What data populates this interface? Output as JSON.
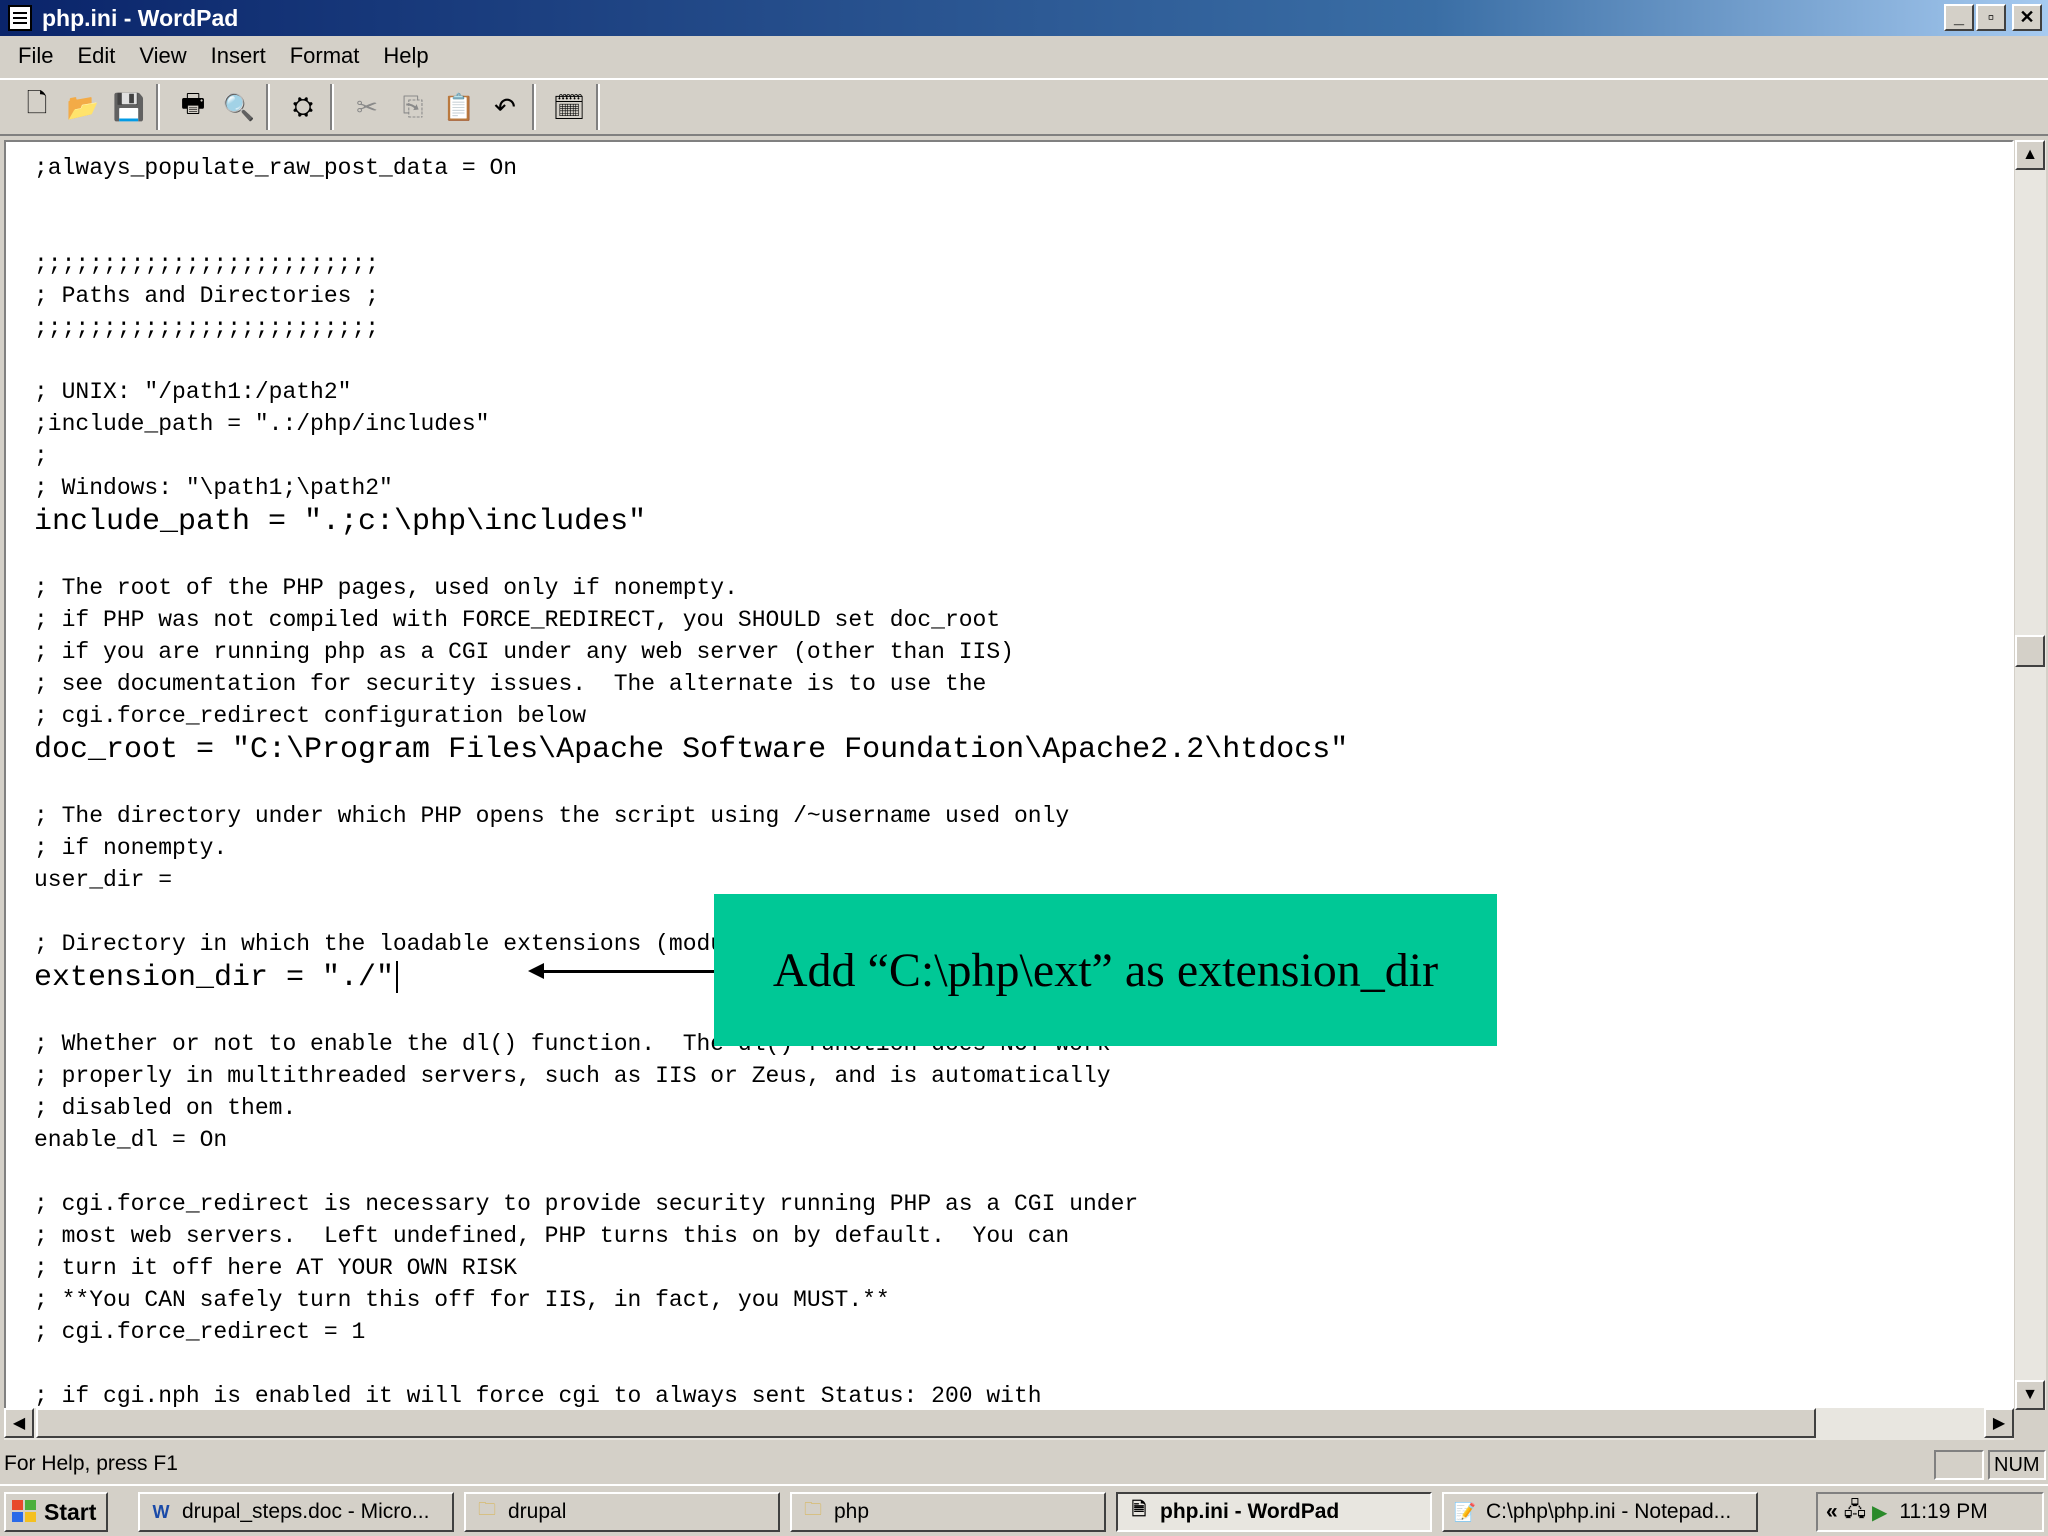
{
  "window": {
    "title": "php.ini - WordPad",
    "controls": {
      "minimize": "_",
      "restore": "▫",
      "close": "✕"
    }
  },
  "menu": [
    "File",
    "Edit",
    "View",
    "Insert",
    "Format",
    "Help"
  ],
  "toolbar": {
    "icons": [
      "new-icon",
      "open-icon",
      "save-icon",
      "print-icon",
      "print-preview-icon",
      "find-icon",
      "cut-icon",
      "copy-icon",
      "paste-icon",
      "undo-icon",
      "date-time-icon"
    ]
  },
  "document": {
    "lines": [
      ";always_populate_raw_post_data = On",
      "",
      "",
      ";;;;;;;;;;;;;;;;;;;;;;;;;",
      "; Paths and Directories ;",
      ";;;;;;;;;;;;;;;;;;;;;;;;;",
      "",
      "; UNIX: \"/path1:/path2\"",
      ";include_path = \".:/php/includes\"",
      ";",
      "; Windows: \"\\path1;\\path2\"",
      "include_path = \".;c:\\php\\includes\"",
      "",
      "; The root of the PHP pages, used only if nonempty.",
      "; if PHP was not compiled with FORCE_REDIRECT, you SHOULD set doc_root",
      "; if you are running php as a CGI under any web server (other than IIS)",
      "; see documentation for security issues.  The alternate is to use the",
      "; cgi.force_redirect configuration below",
      "doc_root = \"C:\\Program Files\\Apache Software Foundation\\Apache2.2\\htdocs\"",
      "",
      "; The directory under which PHP opens the script using /~username used only",
      "; if nonempty.",
      "user_dir =",
      "",
      "; Directory in which the loadable extensions (modules) reside.",
      "extension_dir = \"./\"",
      "",
      "; Whether or not to enable the dl() function.  The dl() function does NOT work",
      "; properly in multithreaded servers, such as IIS or Zeus, and is automatically",
      "; disabled on them.",
      "enable_dl = On",
      "",
      "; cgi.force_redirect is necessary to provide security running PHP as a CGI under",
      "; most web servers.  Left undefined, PHP turns this on by default.  You can",
      "; turn it off here AT YOUR OWN RISK",
      "; **You CAN safely turn this off for IIS, in fact, you MUST.**",
      "; cgi.force_redirect = 1",
      "",
      "; if cgi.nph is enabled it will force cgi to always sent Status: 200 with"
    ]
  },
  "callout": {
    "text": "Add “C:\\php\\ext” as extension_dir"
  },
  "statusbar": {
    "message": "For Help, press F1",
    "num": "NUM"
  },
  "taskbar": {
    "start": "Start",
    "tasks": [
      {
        "label": "drupal_steps.doc - Micro...",
        "icon": "word-icon"
      },
      {
        "label": "drupal",
        "icon": "folder-icon"
      },
      {
        "label": "php",
        "icon": "folder-icon"
      },
      {
        "label": "php.ini - WordPad",
        "icon": "wordpad-icon",
        "active": true
      },
      {
        "label": "C:\\php\\php.ini - Notepad...",
        "icon": "notepad-icon"
      }
    ],
    "clock": "11:19 PM",
    "tray_chevron": "«"
  }
}
